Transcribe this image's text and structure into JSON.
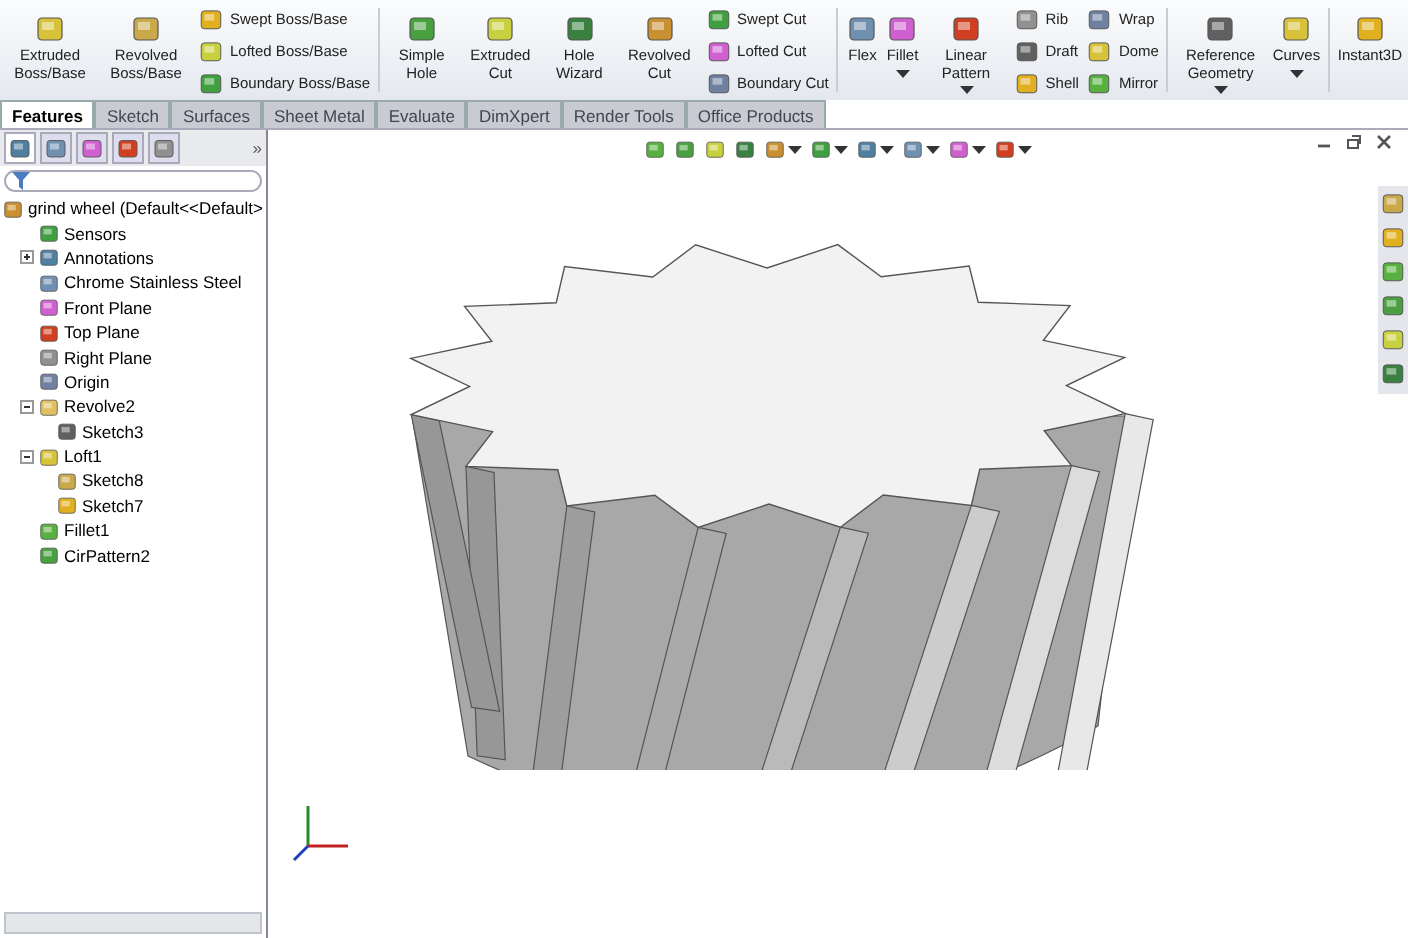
{
  "ribbon": {
    "items": [
      {
        "kind": "large",
        "label": "Extruded Boss/Base",
        "has_menu": false
      },
      {
        "kind": "large",
        "label": "Revolved Boss/Base",
        "has_menu": false
      },
      {
        "kind": "stack",
        "entries": [
          "Swept Boss/Base",
          "Lofted Boss/Base",
          "Boundary Boss/Base"
        ]
      },
      {
        "kind": "separator"
      },
      {
        "kind": "large",
        "label": "Simple Hole",
        "has_menu": false
      },
      {
        "kind": "large",
        "label": "Extruded Cut",
        "has_menu": false
      },
      {
        "kind": "large",
        "label": "Hole Wizard",
        "has_menu": false
      },
      {
        "kind": "large",
        "label": "Revolved Cut",
        "has_menu": false
      },
      {
        "kind": "stack",
        "entries": [
          "Swept Cut",
          "Lofted Cut",
          "Boundary Cut"
        ]
      },
      {
        "kind": "separator"
      },
      {
        "kind": "large",
        "label": "Flex",
        "has_menu": false
      },
      {
        "kind": "large",
        "label": "Fillet",
        "has_menu": true
      },
      {
        "kind": "large",
        "label": "Linear Pattern",
        "has_menu": true
      },
      {
        "kind": "stack",
        "entries": [
          "Rib",
          "Draft",
          "Shell"
        ]
      },
      {
        "kind": "stack",
        "entries": [
          "Wrap",
          "Dome",
          "Mirror"
        ]
      },
      {
        "kind": "separator"
      },
      {
        "kind": "large",
        "label": "Reference Geometry",
        "has_menu": true
      },
      {
        "kind": "large",
        "label": "Curves",
        "has_menu": true
      },
      {
        "kind": "separator"
      },
      {
        "kind": "large",
        "label": "Instant3D",
        "has_menu": false
      }
    ]
  },
  "tabs": [
    {
      "label": "Features",
      "selected": true
    },
    {
      "label": "Sketch",
      "selected": false
    },
    {
      "label": "Surfaces",
      "selected": false
    },
    {
      "label": "Sheet Metal",
      "selected": false
    },
    {
      "label": "Evaluate",
      "selected": false
    },
    {
      "label": "DimXpert",
      "selected": false
    },
    {
      "label": "Render Tools",
      "selected": false
    },
    {
      "label": "Office Products",
      "selected": false
    }
  ],
  "panel": {
    "tabs": [
      {
        "selected": true
      },
      {
        "selected": false
      },
      {
        "selected": false
      },
      {
        "selected": false
      },
      {
        "selected": false
      }
    ],
    "more": "»",
    "tree": {
      "label": "grind wheel  (Default<<Default>",
      "children": [
        {
          "label": "Sensors"
        },
        {
          "label": "Annotations",
          "expanded": false
        },
        {
          "label": "Chrome Stainless Steel"
        },
        {
          "label": "Front Plane"
        },
        {
          "label": "Top Plane"
        },
        {
          "label": "Right Plane"
        },
        {
          "label": "Origin"
        },
        {
          "label": "Revolve2",
          "expanded": true,
          "children": [
            {
              "label": "Sketch3"
            }
          ]
        },
        {
          "label": "Loft1",
          "expanded": true,
          "children": [
            {
              "label": "Sketch8"
            },
            {
              "label": "Sketch7"
            }
          ]
        },
        {
          "label": "Fillet1"
        },
        {
          "label": "CirPattern2"
        }
      ]
    }
  }
}
